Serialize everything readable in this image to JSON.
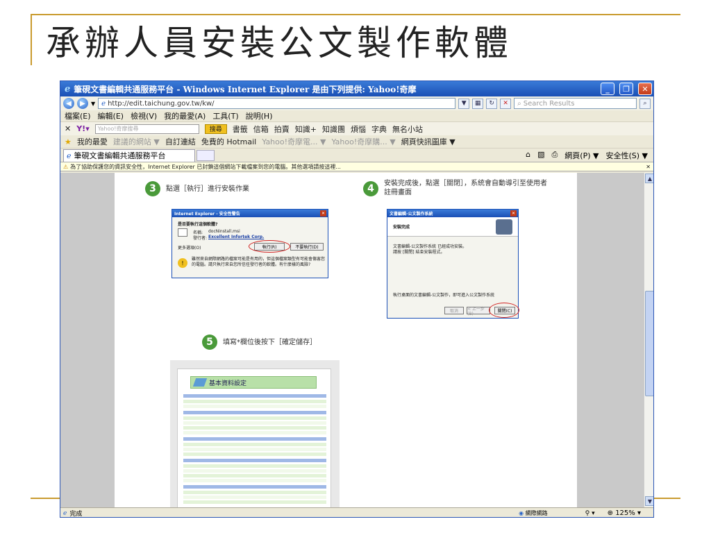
{
  "slide": {
    "title": "承辦人員安裝公文製作軟體"
  },
  "browser": {
    "window_title": "筆硯文書編輯共通服務平台 - Windows Internet Explorer 是由下列提供: Yahoo!奇摩",
    "address_url": "http://edit.taichung.gov.tw/kw/",
    "search_placeholder": "Search Results",
    "menu": [
      "檔案(E)",
      "編輯(E)",
      "檢視(V)",
      "我的最愛(A)",
      "工具(T)",
      "說明(H)"
    ],
    "yahoo_toolbar": {
      "search_placeholder": "Yahoo!奇摩搜尋",
      "search_button": "搜尋",
      "items": [
        "書籤",
        "信箱",
        "拍賣",
        "知識+",
        "知識團",
        "煩惱",
        "字典",
        "無名小站"
      ]
    },
    "favorites_bar": {
      "label": "我的最愛",
      "items": [
        "建議的網站 ▼",
        "自訂連結",
        "免費的 Hotmail",
        "Yahoo!奇摩電... ▼",
        "Yahoo!奇摩購... ▼",
        "網頁快訊圖庫 ▼"
      ]
    },
    "tab_title": "筆硯文書編輯共通服務平台",
    "tab_tools": [
      "網頁(P) ▼",
      "安全性(S) ▼"
    ],
    "infobar_text": "為了協助保護您的資訊安全性，Internet Explorer 已封鎖這個網站下載檔案到您的電腦。其他選項請按這裡...",
    "status_left": "完成",
    "status_zone": "網際網路",
    "zoom_level": "125%"
  },
  "steps": [
    {
      "number": "3",
      "text": "點選［執行］進行安裝作業"
    },
    {
      "number": "4",
      "text": "安裝完成後，點選［關閉］，系統會自動導引至使用者註冊畫面"
    },
    {
      "number": "5",
      "text": "填寫*欄位後按下［確定儲存］"
    }
  ],
  "dialog_security": {
    "title": "Internet Explorer - 安全性警告",
    "question": "是否要執行這個軟體?",
    "name_label": "名稱:",
    "name_value": "docNinstall.msi",
    "publisher_label": "發行者:",
    "publisher_value": "Excellent Infortek Corp.",
    "more_options": "更多選項(O)",
    "run_button": "執行(R)",
    "dont_run_button": "不要執行(D)",
    "warning": "雖然來自網際網路的檔案可能是有用的，但這個檔案類型有可能會傷害您的電腦。請只執行來自您所信任發行者的軟體。有什麼樣的風險?"
  },
  "dialog_install": {
    "title": "文書編輯-公文製作系統",
    "heading": "安裝完成",
    "line1": "文書編輯-公文製作系統 已經成功安裝。",
    "line2": "請按 [關閉] 結束安裝程式。",
    "footer": "執行桌面的文書編輯-公文製作，即可進入公文製作系統",
    "cancel_button": "取消",
    "back_button": "< 上一步(B)",
    "close_button": "關閉(C)"
  },
  "form": {
    "header": "基本資料設定"
  }
}
